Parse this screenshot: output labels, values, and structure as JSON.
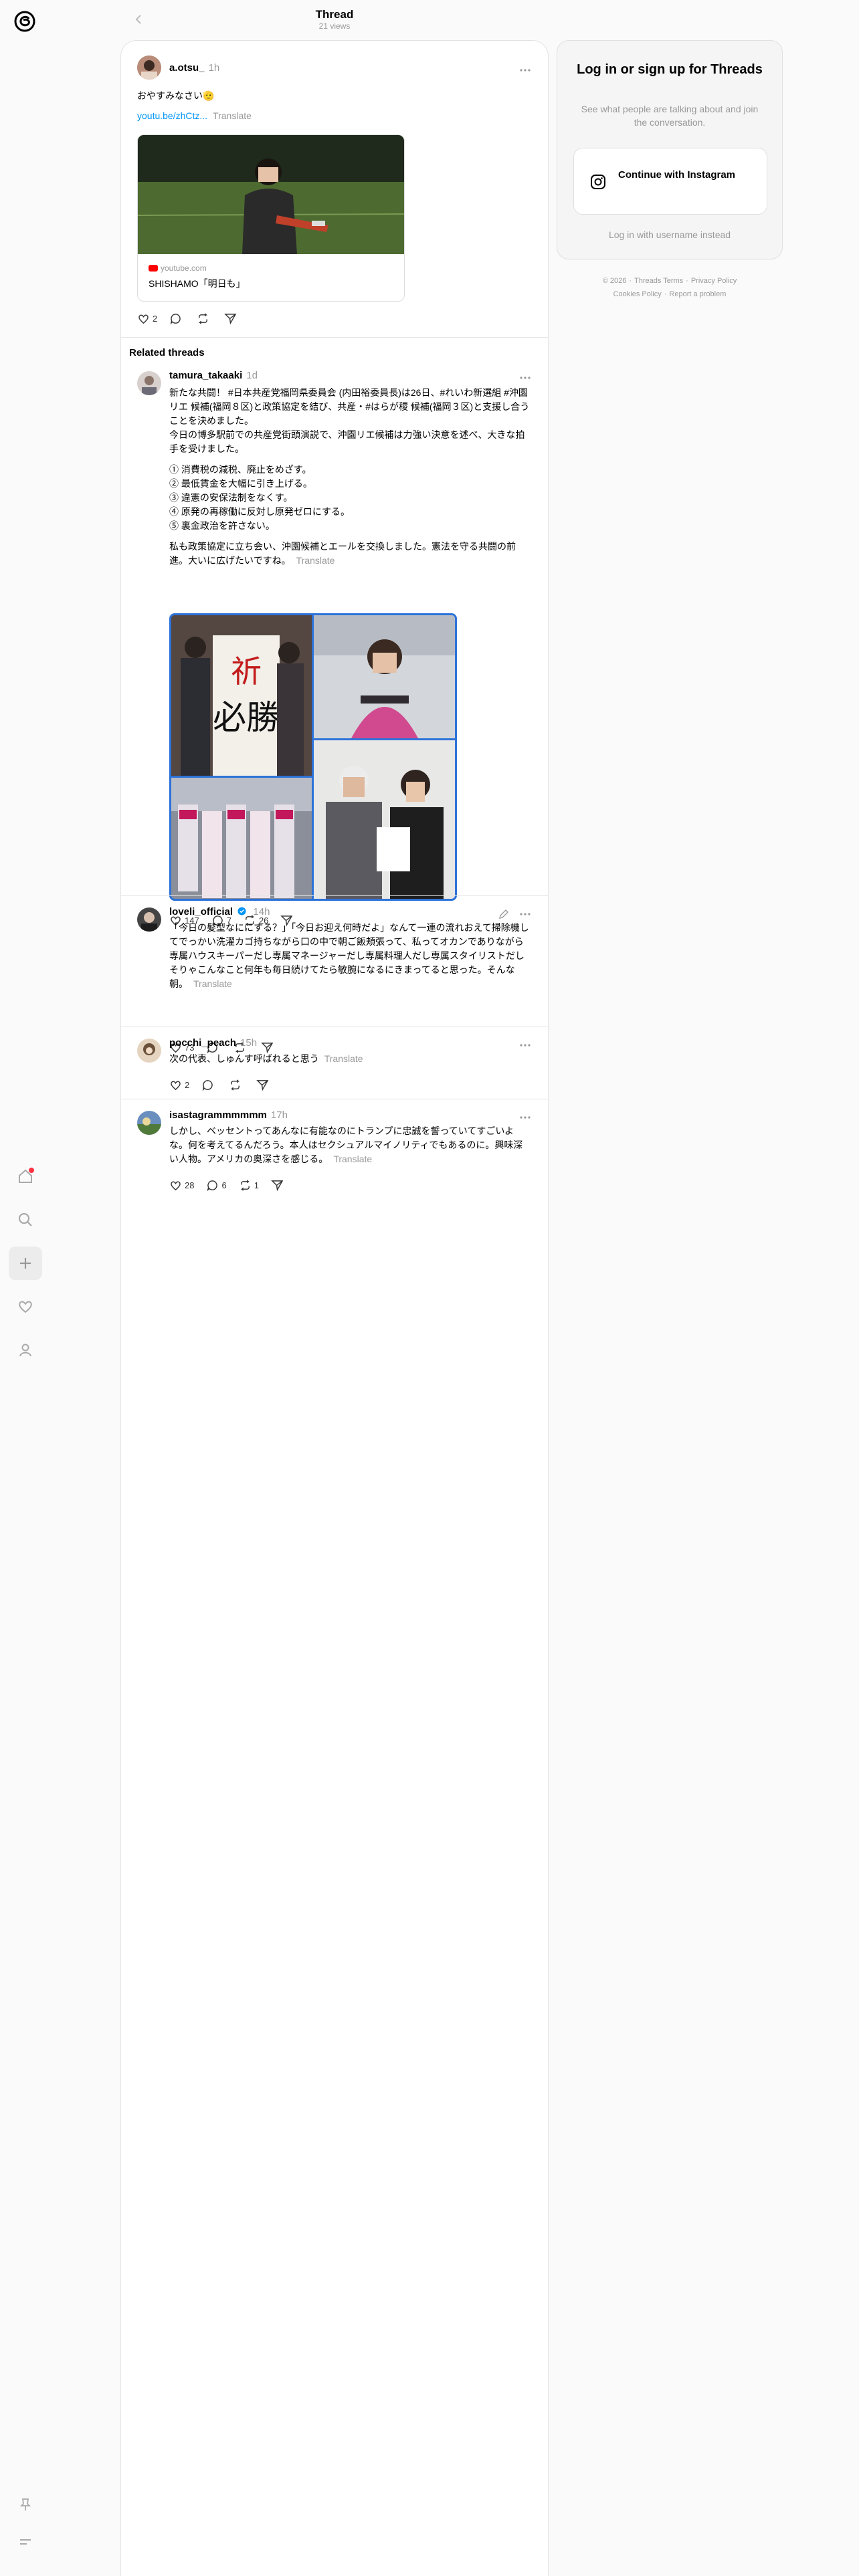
{
  "header": {
    "title": "Thread",
    "views": "21 views"
  },
  "main_post": {
    "username": "a.otsu_",
    "time": "1h",
    "text": "おやすみなさい🫡",
    "link": "youtu.be/zhCtz...",
    "translate": "Translate",
    "card": {
      "source": "youtube.com",
      "title": "SHISHAMO「明日も」"
    },
    "likes": "2"
  },
  "related_heading": "Related threads",
  "posts": [
    {
      "username": "tamura_takaaki",
      "time": "1d",
      "paragraphs": [
        "新たな共闘！ #日本共産党福岡県委員会 (内田裕委員長)は26日、#れいわ新選組 #沖園リエ 候補(福岡８区)と政策協定を結び、共産・#はらが稷 候補(福岡３区)と支援し合うことを決めました。",
        "今日の博多駅前での共産党街頭演説で、沖園リエ候補は力強い決意を述べ、大きな拍手を受けました。"
      ],
      "list": [
        "① 消費税の減税、廃止をめざす。",
        "② 最低賃金を大幅に引き上げる。",
        "③ 違憲の安保法制をなくす。",
        "④ 原発の再稼働に反対し原発ゼロにする。",
        "⑤ 裏金政治を許さない。"
      ],
      "closing": "私も政策協定に立ち会い、沖園候補とエールを交換しました。憲法を守る共闘の前進。大いに広げたいですね。",
      "translate": "Translate",
      "likes": "147",
      "replies": "7",
      "reposts": "26"
    },
    {
      "username": "loveli_official",
      "time": "14h",
      "text": "「今日の髪型なににする？」「今日お迎え何時だよ」なんて一連の流れおえて掃除機してでっかい洗濯カゴ持ちながら口の中で朝ご飯頬張って、私ってオカンでありながら専属ハウスキーパーだし専属マネージャーだし専属料理人だし専属スタイリストだしそりゃこんなこと何年も毎日続けてたら敏腕になるにきまってると思った。そんな朝。",
      "translate": "Translate",
      "likes": "73"
    },
    {
      "username": "pocchi_peach",
      "time": "15h",
      "text": "次の代表、しゅんす呼ばれると思う",
      "translate": "Translate",
      "likes": "2"
    },
    {
      "username": "isastagrammmmmm",
      "time": "17h",
      "text": "しかし、ベッセントってあんなに有能なのにトランプに忠誠を誓っていてすごいよな。何を考えてるんだろう。本人はセクシュアルマイノリティでもあるのに。興味深い人物。アメリカの奥深さを感じる。",
      "translate": "Translate",
      "likes": "28",
      "replies": "6",
      "reposts": "1"
    }
  ],
  "login": {
    "title": "Log in or sign up for Threads",
    "subtitle": "See what people are talking about and join the conversation.",
    "instagram_button": "Continue with Instagram",
    "username_login": "Log in with username instead"
  },
  "footer": [
    "© 2026",
    "Threads Terms",
    "Privacy Policy",
    "Cookies Policy",
    "Report a problem"
  ],
  "colors": {
    "accent": "#0095f6",
    "notification": "#ff3040",
    "grid_border": "#2d72d9"
  }
}
